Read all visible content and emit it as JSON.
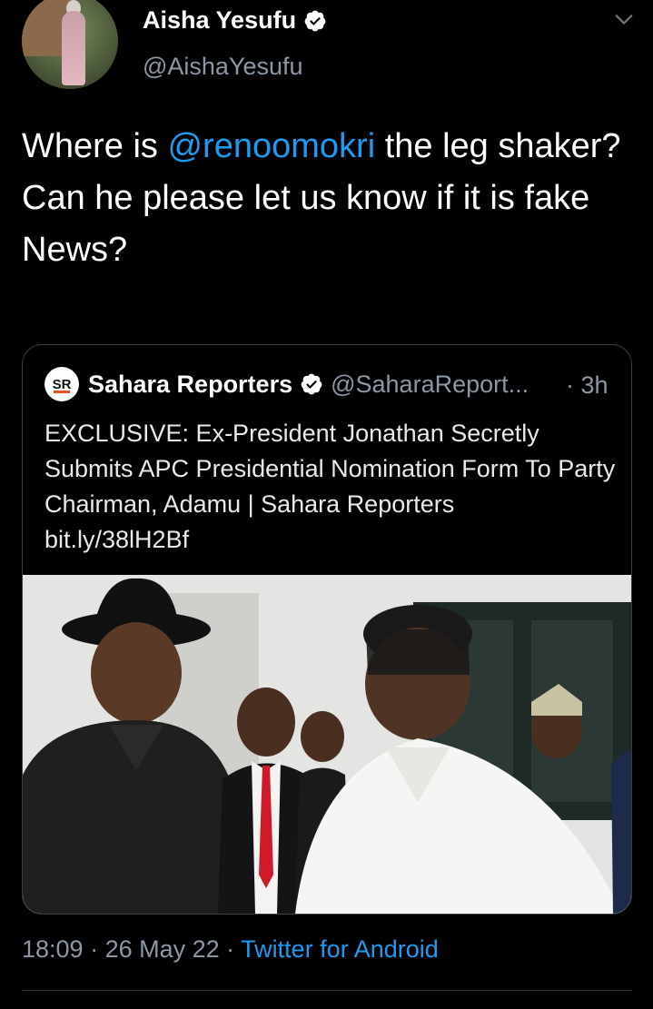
{
  "author": {
    "name": "Aisha Yesufu",
    "handle": "@AishaYesufu"
  },
  "tweet": {
    "text_before": "Where is ",
    "mention": "@renoomokri",
    "text_after": " the leg shaker?",
    "line2": "Can he please let us know if it is fake News?"
  },
  "quoted": {
    "logo_text": "SR",
    "name": "Sahara Reporters",
    "handle": "@SaharaReport...",
    "time": "· 3h",
    "text": "EXCLUSIVE: Ex-President Jonathan Secretly Submits APC Presidential Nomination Form To Party Chairman, Adamu | Sahara Reporters",
    "link": "bit.ly/38lH2Bf"
  },
  "meta": {
    "time": "18:09",
    "sep1": " · ",
    "date": "26 May 22",
    "sep2": " · ",
    "app": "Twitter for Android"
  },
  "colors": {
    "background": "#000000",
    "link": "#1d9bf0",
    "muted": "#8b98a5"
  }
}
